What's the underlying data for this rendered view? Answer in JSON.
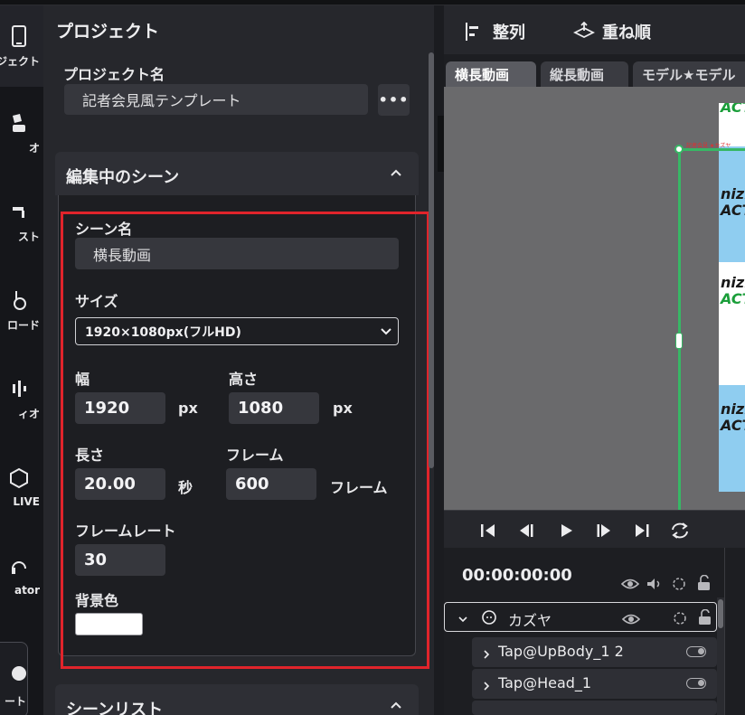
{
  "rail": {
    "items": [
      {
        "label": "ジェクト",
        "icon": "phone-icon"
      },
      {
        "label": "オ",
        "icon": "character-icon"
      },
      {
        "label": "スト",
        "icon": "pin-icon"
      },
      {
        "label": "ロード",
        "icon": "upload-icon"
      },
      {
        "label": "ィオ",
        "icon": "audio-icon"
      },
      {
        "label": "LIVE",
        "icon": "live-icon"
      },
      {
        "label": "ator",
        "icon": "headset-icon"
      },
      {
        "label": "ート",
        "icon": "support-icon"
      }
    ]
  },
  "panel": {
    "title": "プロジェクト",
    "project_name_label": "プロジェクト名",
    "project_name_value": "記者会見風テンプレート",
    "more_label": "•••"
  },
  "scene": {
    "section_title": "編集中のシーン",
    "name_label": "シーン名",
    "name_value": "横長動画",
    "size_label": "サイズ",
    "size_value": "1920×1080px(フルHD)",
    "width_label": "幅",
    "width_value": "1920",
    "width_unit": "px",
    "height_label": "高さ",
    "height_value": "1080",
    "height_unit": "px",
    "length_label": "長さ",
    "length_value": "20.00",
    "length_unit": "秒",
    "frame_label": "フレーム",
    "frame_value": "600",
    "frame_unit": "フレーム",
    "framerate_label": "フレームレート",
    "framerate_value": "30",
    "bgcolor_label": "背景色",
    "bgcolor_value": "#ffffff"
  },
  "scene_list": {
    "section_title": "シーンリスト"
  },
  "toolbar": {
    "align_label": "整列",
    "order_label": "重ね順"
  },
  "tabs": [
    {
      "label": "横長動画",
      "active": true
    },
    {
      "label": "縦長動画",
      "active": false
    },
    {
      "label": "モデル★モデル",
      "active": false
    }
  ],
  "preview": {
    "texts": [
      "ACT",
      "nizi",
      "ACT",
      "nizi",
      "ACT",
      "nizi",
      "ACT"
    ],
    "tiny_label": "記者会見 ★カズヤ"
  },
  "timeline": {
    "timecode": "00:00:00:00",
    "rows": [
      {
        "label": "カズヤ",
        "type": "group"
      },
      {
        "label": "Tap@UpBody_1 2",
        "type": "child"
      },
      {
        "label": "Tap@Head_1",
        "type": "child"
      }
    ]
  },
  "colors": {
    "highlight": "#e0242b",
    "guide": "#37b765",
    "accent_bg": "#26272c"
  }
}
